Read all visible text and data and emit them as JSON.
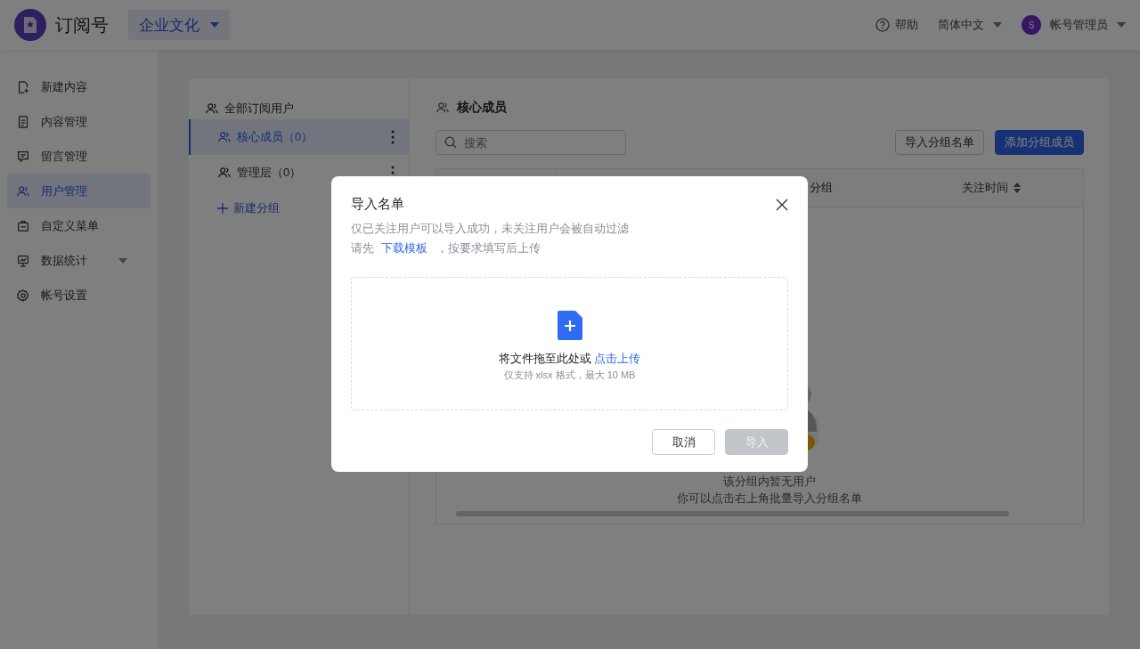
{
  "app": {
    "title": "订阅号",
    "workspace": "企业文化"
  },
  "header": {
    "help": "帮助",
    "language": "简体中文",
    "account": {
      "avatar": "S",
      "name": "帐号管理员"
    }
  },
  "sidebar": {
    "items": [
      {
        "label": "新建内容",
        "selected": false,
        "expandable": false
      },
      {
        "label": "内容管理",
        "selected": false,
        "expandable": false
      },
      {
        "label": "留言管理",
        "selected": false,
        "expandable": false
      },
      {
        "label": "用户管理",
        "selected": true,
        "expandable": false
      },
      {
        "label": "自定义菜单",
        "selected": false,
        "expandable": false
      },
      {
        "label": "数据统计",
        "selected": false,
        "expandable": true
      },
      {
        "label": "帐号设置",
        "selected": false,
        "expandable": false
      }
    ]
  },
  "groups": {
    "all": "全部订阅用户",
    "items": [
      {
        "label": "核心成员（0）",
        "selected": true
      },
      {
        "label": "管理层（0）",
        "selected": false
      }
    ],
    "new_group": "新建分组"
  },
  "panel": {
    "title": "核心成员",
    "search": {
      "placeholder": "搜索"
    },
    "buttons": [
      {
        "label": "导入分组名单",
        "kind": "default"
      },
      {
        "label": "添加分组成员",
        "kind": "primary"
      }
    ],
    "table": {
      "columns": [
        {
          "label": "分组",
          "sortable": false
        },
        {
          "label": "关注时间",
          "sortable": true
        }
      ],
      "empty": [
        "该分组内暂无用户",
        "你可以点击右上角批量导入分组名单"
      ]
    }
  },
  "dialog": {
    "title": "导入名单",
    "notice": "仅已关注用户可以导入成功，未关注用户会被自动过滤",
    "hint": {
      "before": "请先",
      "link": "下载模板",
      "after": "，按要求填写后上传"
    },
    "dropzone": {
      "text": "将文件拖至此处或",
      "link": "点击上传",
      "note": "仅支持 xlsx 格式，最大 10 MB"
    },
    "buttons": [
      {
        "label": "取消",
        "kind": "default",
        "disabled": false
      },
      {
        "label": "导入",
        "kind": "primary",
        "disabled": true
      }
    ]
  }
}
